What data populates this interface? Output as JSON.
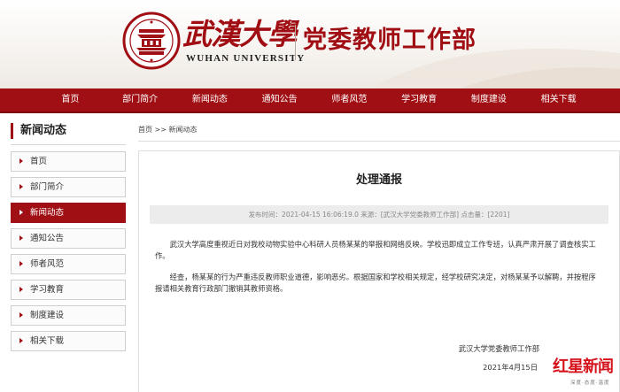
{
  "header": {
    "logo_calligraphy": "武漢大學",
    "logo_english": "WUHAN UNIVERSITY",
    "site_title": "党委教师工作部"
  },
  "nav": {
    "items": [
      {
        "label": "首页"
      },
      {
        "label": "部门简介"
      },
      {
        "label": "新闻动态"
      },
      {
        "label": "通知公告"
      },
      {
        "label": "师者风范"
      },
      {
        "label": "学习教育"
      },
      {
        "label": "制度建设"
      },
      {
        "label": "相关下载"
      }
    ]
  },
  "sidebar": {
    "heading": "新闻动态",
    "active_index": 2,
    "items": [
      {
        "label": "首页"
      },
      {
        "label": "部门简介"
      },
      {
        "label": "新闻动态"
      },
      {
        "label": "通知公告"
      },
      {
        "label": "师者风范"
      },
      {
        "label": "学习教育"
      },
      {
        "label": "制度建设"
      },
      {
        "label": "相关下载"
      }
    ]
  },
  "breadcrumb": "首页 >> 新闻动态",
  "article": {
    "title": "处理通报",
    "meta": "发布时间：2021-04-15 16:06:19.0 来源：[武汉大学党委教师工作部] 点击量：[2201]",
    "paragraphs": [
      "武汉大学高度重视近日对我校动物实验中心科研人员杨某某的举报和网络反映。学校迅即成立工作专班，认真严肃开展了调查核实工作。",
      "经查，杨某某的行为严重违反教师职业道德，影响恶劣。根据国家和学校相关规定，经学校研究决定，对杨某某予以解聘，并按程序报请相关教育行政部门撤销其教师资格。"
    ],
    "signature_org": "武汉大学党委教师工作部",
    "signature_date": "2021年4月15日"
  },
  "watermark": {
    "name": "红星新闻",
    "sub": "深度·态度·温度"
  },
  "colors": {
    "brand_red": "#a00f13",
    "nav_dark": "#7d0a0e"
  }
}
